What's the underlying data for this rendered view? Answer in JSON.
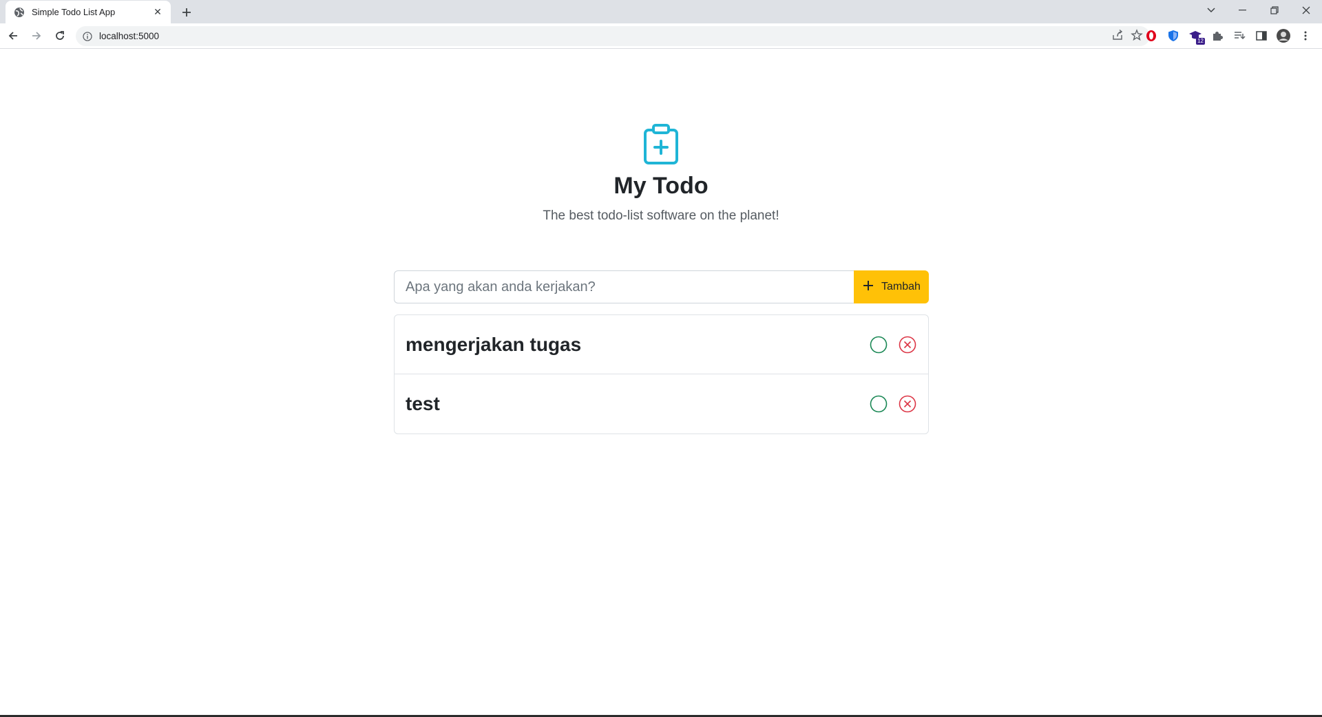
{
  "browser": {
    "tab_title": "Simple Todo List App",
    "url": "localhost:5000",
    "extension_badge": "12"
  },
  "app": {
    "title": "My Todo",
    "subtitle": "The best todo-list software on the planet!",
    "input_placeholder": "Apa yang akan anda kerjakan?",
    "input_value": "",
    "add_label": "Tambah",
    "todos": [
      {
        "text": "mengerjakan tugas"
      },
      {
        "text": "test"
      }
    ]
  },
  "colors": {
    "accent_icon": "#1fb5d6",
    "add_button": "#ffc107",
    "complete": "#198754",
    "delete": "#dc3545"
  },
  "icons": {
    "logo": "clipboard-plus-icon",
    "add": "plus-icon",
    "complete": "circle-icon",
    "delete": "x-circle-icon"
  }
}
